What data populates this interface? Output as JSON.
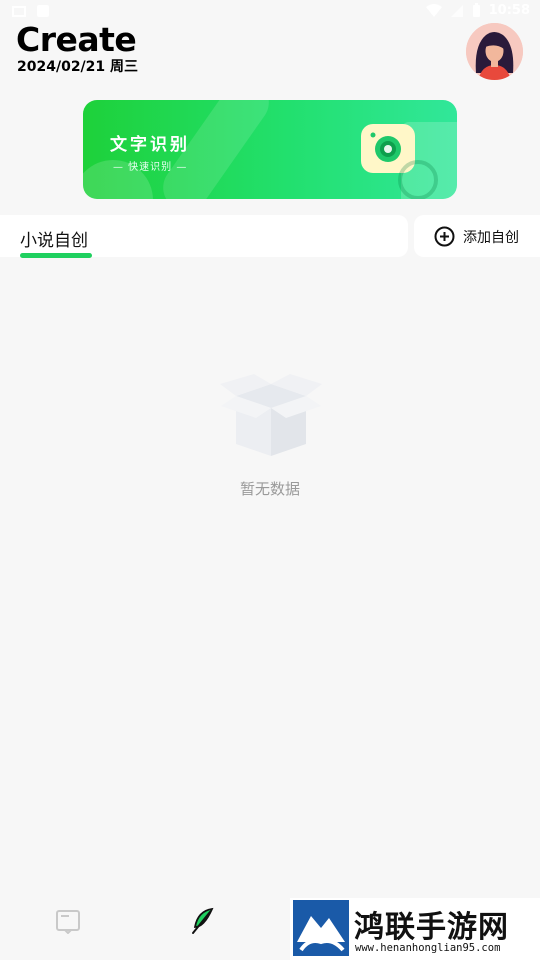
{
  "status_bar": {
    "time": "10:58"
  },
  "header": {
    "title": "Create",
    "date": "2024/02/21 周三"
  },
  "banner": {
    "title": "文字识别",
    "subtitle": "— 快速识别 —"
  },
  "tabs": {
    "active_label": "小说自创",
    "add_label": "添加自创"
  },
  "empty_state": {
    "message": "暂无数据"
  },
  "watermark": {
    "title": "鸿联手游网",
    "url": "www.henanhonglian95.com"
  },
  "colors": {
    "accent": "#1fd05f",
    "banner_start": "#1ed13a",
    "banner_end": "#31e79a",
    "background": "#f7f7f7"
  }
}
